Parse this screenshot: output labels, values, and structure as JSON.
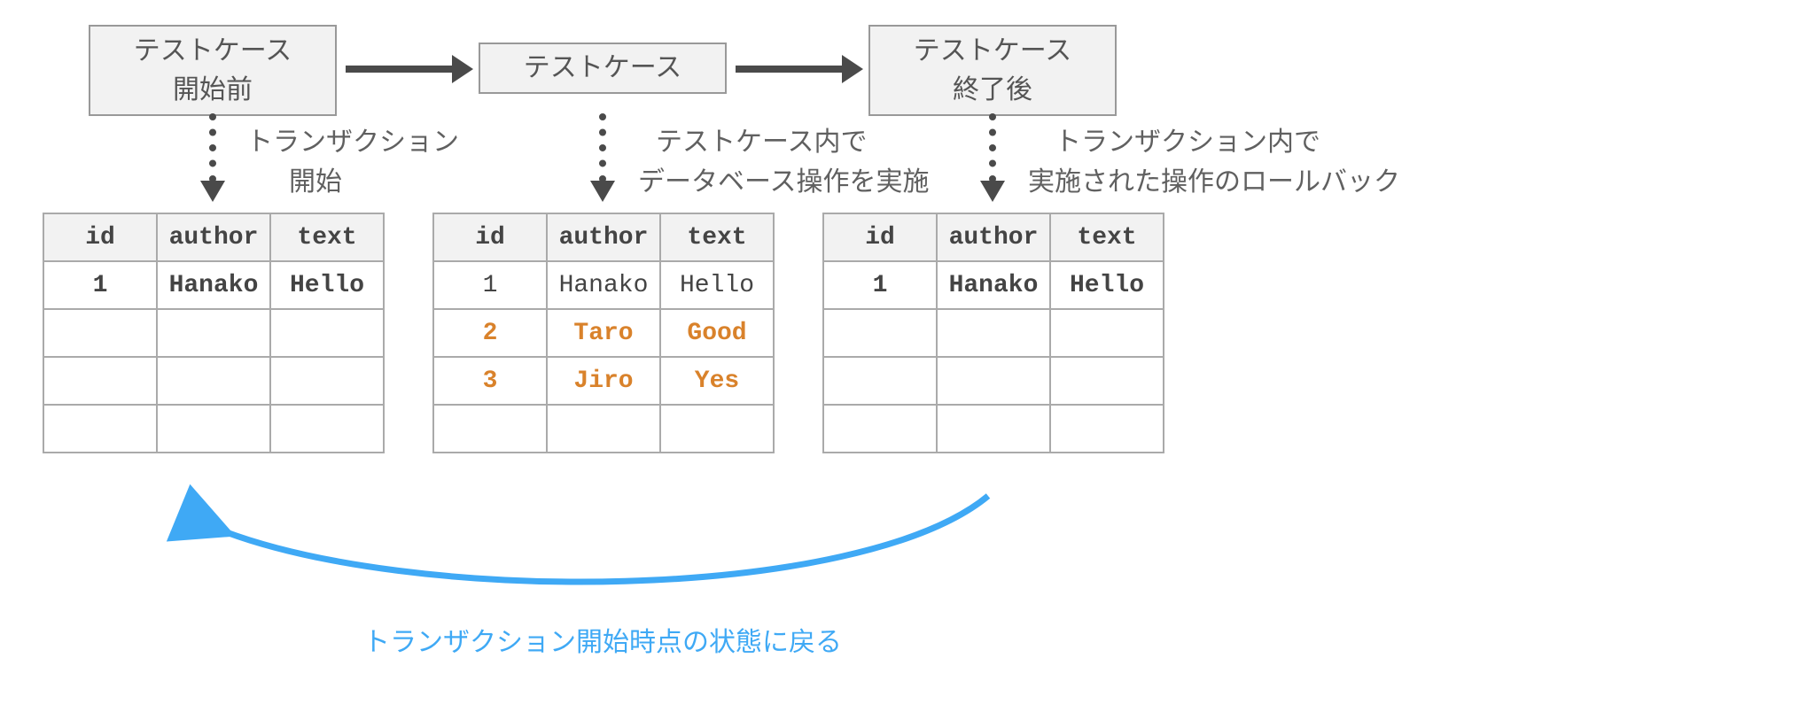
{
  "stages": {
    "before": {
      "line1": "テストケース",
      "line2": "開始前"
    },
    "during": {
      "line1": "テストケース"
    },
    "after": {
      "line1": "テストケース",
      "line2": "終了後"
    }
  },
  "annotations": {
    "tx_begin": {
      "line1": "トランザクション",
      "line2": "開始"
    },
    "db_ops": {
      "line1": "テストケース内で",
      "line2": "データベース操作を実施"
    },
    "rollback_op": {
      "line1": "トランザクション内で",
      "line2": "実施された操作のロールバック"
    }
  },
  "table_headers": {
    "id": "id",
    "author": "author",
    "text": "text"
  },
  "tables": {
    "before": {
      "rows": [
        {
          "id": "1",
          "author": "Hanako",
          "text": "Hello",
          "style": "bold"
        },
        {
          "id": "",
          "author": "",
          "text": ""
        },
        {
          "id": "",
          "author": "",
          "text": ""
        },
        {
          "id": "",
          "author": "",
          "text": ""
        }
      ]
    },
    "during": {
      "rows": [
        {
          "id": "1",
          "author": "Hanako",
          "text": "Hello",
          "style": ""
        },
        {
          "id": "2",
          "author": "Taro",
          "text": "Good",
          "style": "hl"
        },
        {
          "id": "3",
          "author": "Jiro",
          "text": "Yes",
          "style": "hl"
        },
        {
          "id": "",
          "author": "",
          "text": ""
        }
      ]
    },
    "after": {
      "rows": [
        {
          "id": "1",
          "author": "Hanako",
          "text": "Hello",
          "style": "bold"
        },
        {
          "id": "",
          "author": "",
          "text": ""
        },
        {
          "id": "",
          "author": "",
          "text": ""
        },
        {
          "id": "",
          "author": "",
          "text": ""
        }
      ]
    }
  },
  "rollback_caption": "トランザクション開始時点の状態に戻る",
  "colors": {
    "box_bg": "#f2f2f2",
    "box_border": "#999999",
    "arrow": "#4a4a4a",
    "highlight": "#d9822b",
    "rollback": "#3fa9f5",
    "text": "#555555"
  }
}
